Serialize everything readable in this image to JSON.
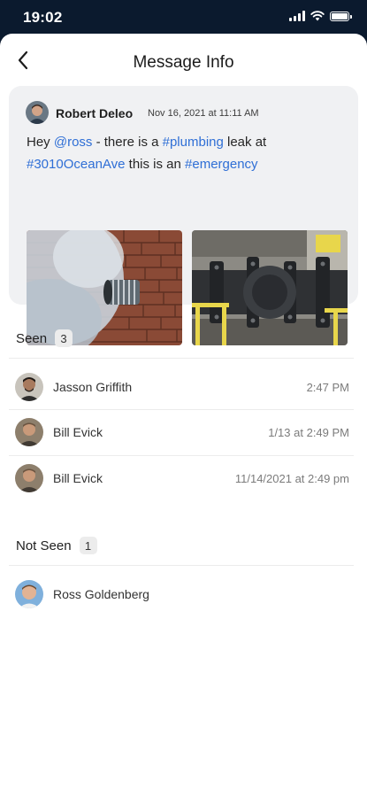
{
  "status_bar": {
    "time": "19:02",
    "icons": [
      "signal-icon",
      "wifi-icon",
      "battery-icon"
    ]
  },
  "header": {
    "title": "Message Info",
    "back_icon": "chevron-left-icon"
  },
  "message": {
    "sender_name": "Robert Deleo",
    "sent_at": "Nov 16, 2021 at 11:11 AM",
    "text_segments": [
      {
        "text": "Hey ",
        "tag": false
      },
      {
        "text": "@ross",
        "tag": true
      },
      {
        "text": " - there is a ",
        "tag": false
      },
      {
        "text": "#plumbing",
        "tag": true
      },
      {
        "text": " leak at ",
        "tag": false
      },
      {
        "text": "#3010OceanAve",
        "tag": true
      },
      {
        "text": " this is an ",
        "tag": false
      },
      {
        "text": "#emergency",
        "tag": true
      }
    ],
    "attachments": [
      "steam-leak-photo",
      "pipe-valve-photo"
    ]
  },
  "seen": {
    "label": "Seen",
    "count": "3",
    "rows": [
      {
        "name": "Jasson Griffith",
        "time": "2:47 PM"
      },
      {
        "name": "Bill Evick",
        "time": "1/13 at 2:49 PM"
      },
      {
        "name": "Bill Evick",
        "time": "11/14/2021 at 2:49 pm"
      }
    ]
  },
  "not_seen": {
    "label": "Not Seen",
    "count": "1",
    "rows": [
      {
        "name": "Ross Goldenberg"
      }
    ]
  },
  "colors": {
    "status_bar_bg": "#0b1a2e",
    "card_bg": "#f0f1f3",
    "tag_blue": "#2f6fd6",
    "secondary_text": "#7b7b7b"
  }
}
